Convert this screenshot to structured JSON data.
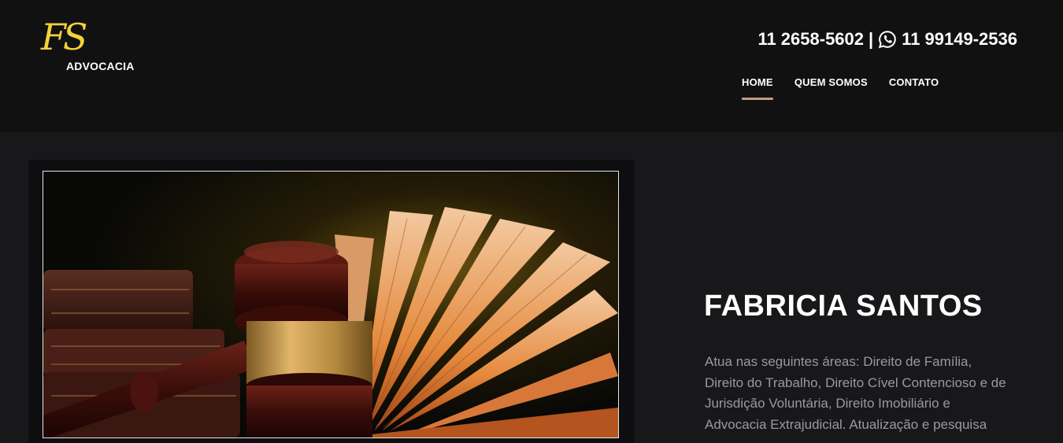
{
  "header": {
    "logo": {
      "mark": "FS",
      "text": "ADVOCACIA"
    },
    "phones": {
      "landline": "11 2658-5602",
      "separator": "|",
      "mobile": "11 99149-2536",
      "mobile_icon": "whatsapp-icon"
    },
    "nav": [
      {
        "label": "HOME",
        "active": true
      },
      {
        "label": "QUEM SOMOS",
        "active": false
      },
      {
        "label": "CONTATO",
        "active": false
      }
    ]
  },
  "main": {
    "image": {
      "icon": "gavel-and-book-photo"
    },
    "profile": {
      "name": "FABRICIA SANTOS",
      "description": "Atua nas seguintes áreas: Direito de Família, Direito do Trabalho, Direito Cível Contencioso e de Jurisdição Voluntária, Direito Imobiliário e Advocacia Extrajudicial. Atualização e pesquisa"
    }
  },
  "colors": {
    "accent": "#f2d23a",
    "nav_underline": "#c49a86",
    "header_bg": "#111112",
    "page_bg": "#18181a",
    "text_muted": "#9a9a9d"
  }
}
